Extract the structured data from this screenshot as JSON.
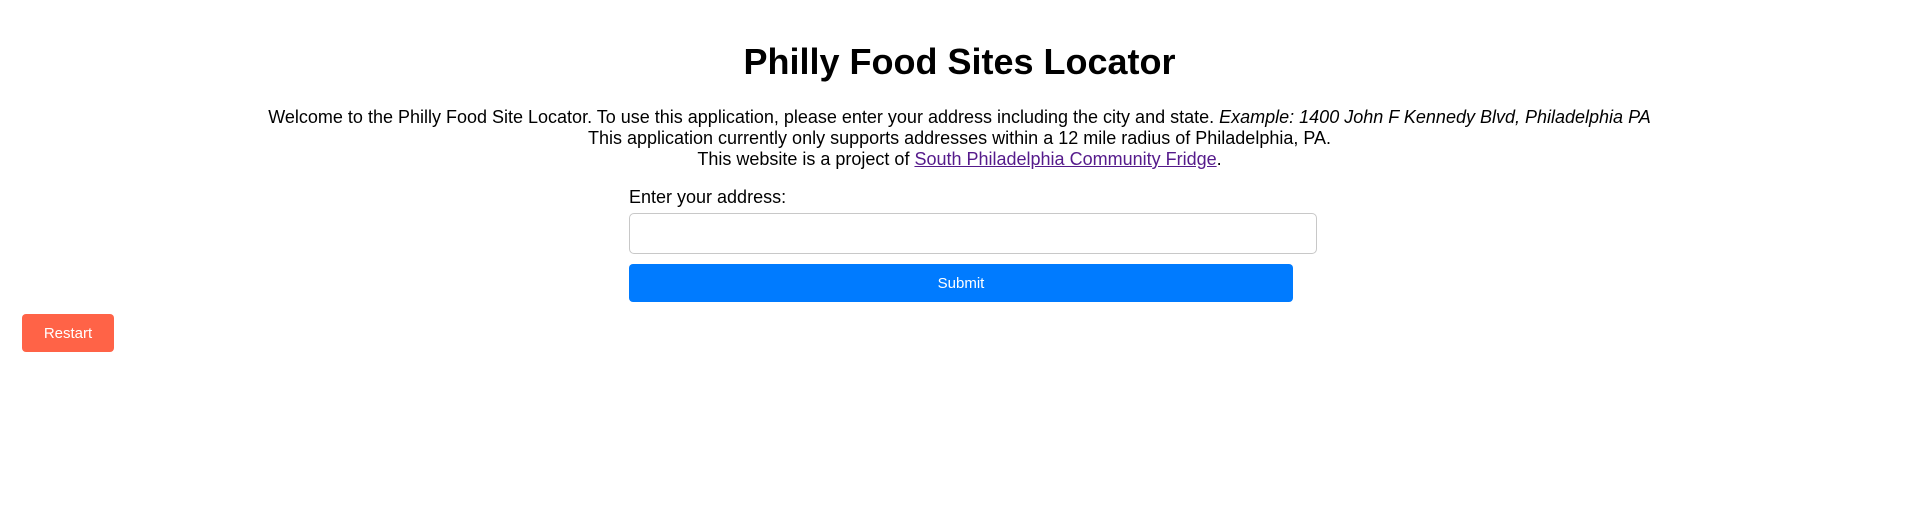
{
  "header": {
    "title": "Philly Food Sites Locator"
  },
  "intro": {
    "line1_text": "Welcome to the Philly Food Site Locator. To use this application, please enter your address including the city and state. ",
    "line1_example": "Example: 1400 John F Kennedy Blvd, Philadelphia PA",
    "line2_text": "This application currently only supports addresses within a 12 mile radius of Philadelphia, PA.",
    "line3_prefix": "This website is a project of ",
    "line3_link": "South Philadelphia Community Fridge",
    "line3_suffix": "."
  },
  "form": {
    "address_label": "Enter your address:",
    "address_value": "",
    "address_placeholder": "",
    "submit_label": "Submit"
  },
  "restart": {
    "label": "Restart"
  },
  "colors": {
    "submit_bg": "#007bff",
    "restart_bg": "#ff6347",
    "visited_link": "#551a8b"
  }
}
